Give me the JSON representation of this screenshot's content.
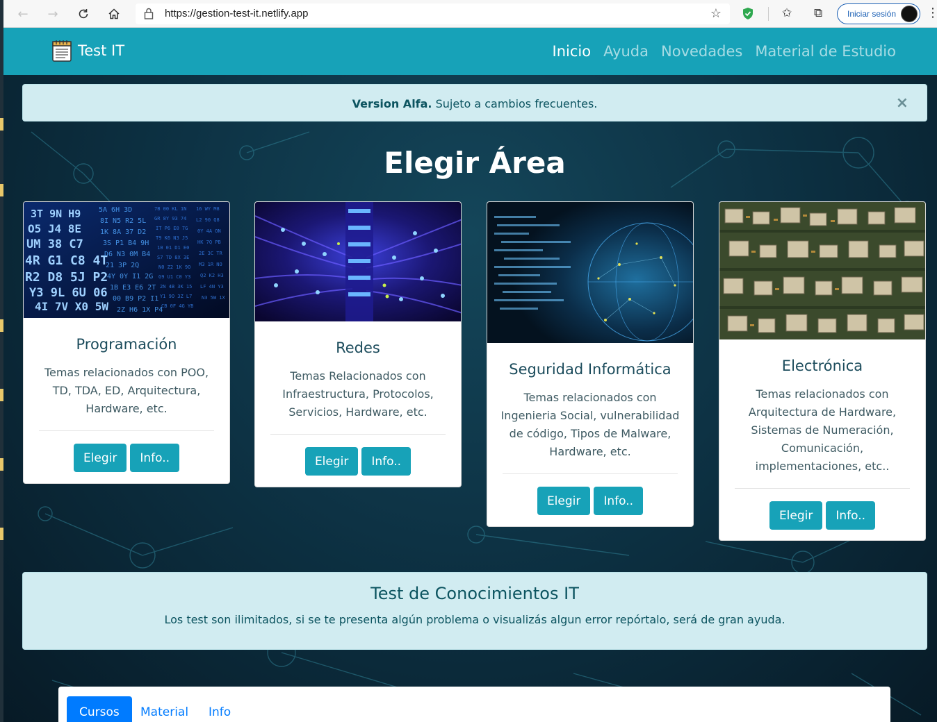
{
  "browser": {
    "url": "https://gestion-test-it.netlify.app",
    "signin_label": "Iniciar sesión"
  },
  "navbar": {
    "brand": "Test IT",
    "links": [
      "Inicio",
      "Ayuda",
      "Novedades",
      "Material de Estudio"
    ]
  },
  "alert": {
    "bold": "Version Alfa.",
    "text": " Sujeto a cambios frecuentes.",
    "close": "×"
  },
  "heading": "Elegir Área",
  "cards": [
    {
      "title": "Programación",
      "text": "Temas relacionados con POO, TD, TDA, ED, Arquitectura, Hardware, etc.",
      "btn_choose": "Elegir",
      "btn_info": "Info.."
    },
    {
      "title": "Redes",
      "text": "Temas Relacionados con Infraestructura, Protocolos, Servicios, Hardware, etc.",
      "btn_choose": "Elegir",
      "btn_info": "Info.."
    },
    {
      "title": "Seguridad Informática",
      "text": "Temas relacionados con Ingenieria Social, vulnerabilidad de código, Tipos de Malware, Hardware, etc.",
      "btn_choose": "Elegir",
      "btn_info": "Info.."
    },
    {
      "title": "Electrónica",
      "text": "Temas relacionados con Arquitectura de Hardware, Sistemas de Numeración, Comunicación, implementaciones, etc..",
      "btn_choose": "Elegir",
      "btn_info": "Info.."
    }
  ],
  "jumbotron": {
    "title": "Test de Conocimientos IT",
    "text": "Los test son ilimitados, si se te presenta algún problema o visualizás algun error repórtalo, será de gran ayuda."
  },
  "tabs": [
    "Cursos",
    "Material",
    "Info"
  ],
  "colors": {
    "primary": "#17a2b8",
    "tab_active": "#007bff",
    "alert_bg": "#d1ecf1"
  }
}
